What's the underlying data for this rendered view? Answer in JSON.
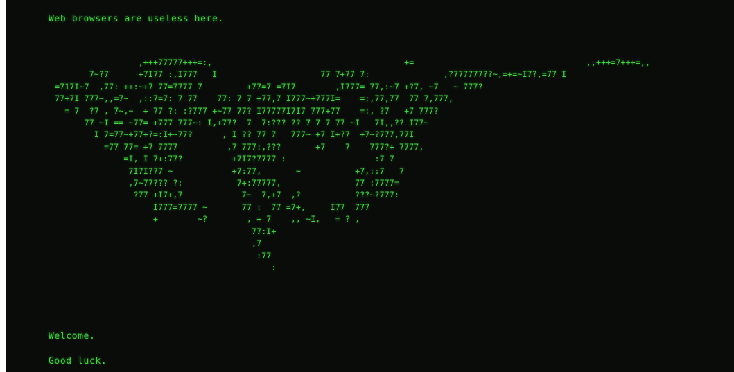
{
  "terminal": {
    "header_text": "Web browsers are useless here.",
    "ascii_art": "                           ,+++77777+++=:,                                       +=                                   ,,+++=7+++=,,\n                 7~?7      +7I77 :,I777   I                     77 7+77 7:               ,?777777??~,=+=~I7?,=77 I\n          =717I~7  ,77: ++:~+7 77=7777 7         +77=7 =7I7        ,I777= 77,:~7 +?7, ~7   ~ 777?\n          77+7I 777~,,=7~  ,::7=7: 7 77    77: 7 7 +77,7 I777~+777I=    =:,77,77  77 7,777,\n            = 7  ?7 , 7~,~  + 77 ?: :?777 +~77 77? I77777I7I7 777+77    =:, ?7   +7 777?\n                77 ~I == ~77= +777 777~: I,+77?  7  7:??? ?? 7 7 7 77 ~I   7I,,?? I77~\n                  I 7=77~+77+?=:I+~77?      , I ?? 77 7   777~ +7 I+?7  +7~?777,77I\n                    =77 77= +7 7777          ,7 777:,???       +7    7    777?+ 7777,\n                        =I, I 7+:77?          +7I7?7777 :                  :7 7\n                         7I7I?77 ~            +7:77,       ~           +7,::7   7\n                         ,7~77??? ?:           7+:77777,               77 :7777=\n                          ?77 +I7+,7            7~  7,+7  ,?           ???~?777:\n                              I777=7777 ~       77 :  77 =7+,     I77  777\n                              +        ~?        , + 7    ,, ~I,   = ? ,\n                                                  77:I+\n                                                  ,7\n                                                   :77\n                                                      :",
    "welcome_text": "Welcome.",
    "goodluck_text": "Good luck.",
    "colors": {
      "background": "#0a0c0a",
      "text": "#3fd23f"
    }
  }
}
